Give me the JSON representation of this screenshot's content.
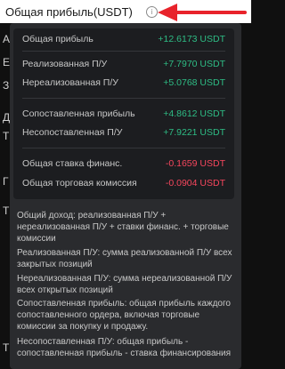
{
  "header": {
    "title": "Общая прибыль(USDT)",
    "info_icon": "info-icon",
    "arrow_icon": "arrow-left-icon",
    "arrow_color": "#e8232b"
  },
  "background_peek": [
    "А",
    "Е",
    "З",
    "Д",
    "Т",
    "Г",
    "Т",
    "Т"
  ],
  "breakdown": {
    "total": {
      "label": "Общая прибыль",
      "value": "+12.6173 USDT"
    },
    "realized": {
      "label": "Реализованная П/У",
      "value": "+7.7970 USDT"
    },
    "unrealized": {
      "label": "Нереализованная П/У",
      "value": "+5.0768 USDT"
    },
    "matched": {
      "label": "Сопоставленная прибыль",
      "value": "+4.8612 USDT"
    },
    "unmatched": {
      "label": "Несопоставленная П/У",
      "value": "+7.9221 USDT"
    },
    "funding": {
      "label": "Общая ставка финанс.",
      "value": "-0.1659 USDT"
    },
    "fee": {
      "label": "Общая торговая комиссия",
      "value": "-0.0904 USDT"
    }
  },
  "descriptions": [
    "Общий доход: реализованная П/У + нереализованная П/У + ставки финанс. + торговые комиссии",
    "Реализованная П/У: сумма реализованной П/У всех закрытых позиций",
    "Нереализованная П/У: сумма нереализованной П/У всех открытых позиций",
    "Сопоставленная прибыль: общая прибыль каждого сопоставленного ордера, включая торговые комиссии за покупку и продажу.",
    "Несопоставленная П/У: общая прибыль - сопоставленная прибыль - ставка финансирования"
  ],
  "colors": {
    "positive": "#2ebd85",
    "negative": "#f6465d",
    "tooltip_bg": "#2a2b2e",
    "card_bg": "#1c1d20"
  }
}
